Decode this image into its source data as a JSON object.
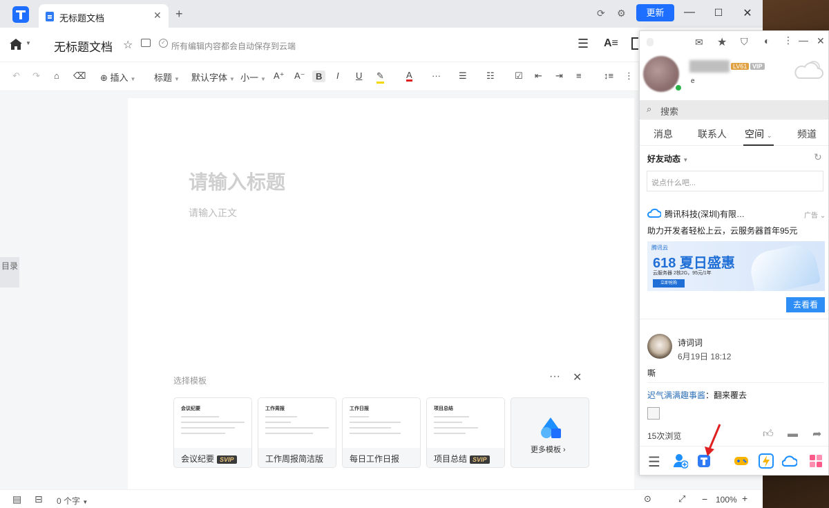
{
  "tab": {
    "title": "无标题文档"
  },
  "window": {
    "update_label": "更新"
  },
  "header": {
    "doc_title": "无标题文档",
    "save_status": "所有编辑内容都会自动保存到云端"
  },
  "toolbar": {
    "insert": "插入",
    "heading": "标题",
    "font": "默认字体",
    "size": "小一",
    "bold": "B",
    "italic": "I",
    "underline": "U",
    "font_color_glyph": "A",
    "more": "···"
  },
  "sidebar": {
    "toc_label": "目录"
  },
  "editor": {
    "title_placeholder": "请输入标题",
    "body_placeholder": "请输入正文",
    "template_label": "选择模板",
    "templates": [
      {
        "name": "会议纪要",
        "badge": "SVIP",
        "preview_title": "会议纪要"
      },
      {
        "name": "工作周报简洁版",
        "badge": "",
        "preview_title": "工作周报"
      },
      {
        "name": "每日工作日报",
        "badge": "",
        "preview_title": "工作日报"
      },
      {
        "name": "项目总结",
        "badge": "SVIP",
        "preview_title": "项目总结"
      },
      {
        "name": "更多模板",
        "badge": "",
        "preview_title": ""
      }
    ]
  },
  "status": {
    "word_count": "0 个字",
    "zoom": "100%"
  },
  "qq": {
    "level_badge": "LV61",
    "vip_badge": "VIP",
    "signature": "e",
    "search_placeholder": "搜索",
    "tabs": [
      "消息",
      "联系人",
      "空间",
      "频道"
    ],
    "feed_title": "好友动态",
    "say_placeholder": "说点什么吧...",
    "ad": {
      "name": "腾讯科技(深圳)有限…",
      "tag": "广告",
      "text": "助力开发者轻松上云，云服务器首年95元",
      "banner_brand": "腾讯云",
      "banner_headline": "618 夏日盛惠",
      "banner_sub": "云服务器 2核2G，95元/1年",
      "banner_cta": "立即抢购",
      "button": "去看看"
    },
    "post": {
      "user": "诗词词",
      "time": "6月19日 18:12",
      "text": "嘶",
      "comment_user": "迟气满满趣事酱",
      "comment_text": "：翻来覆去",
      "views": "15次浏览"
    }
  }
}
